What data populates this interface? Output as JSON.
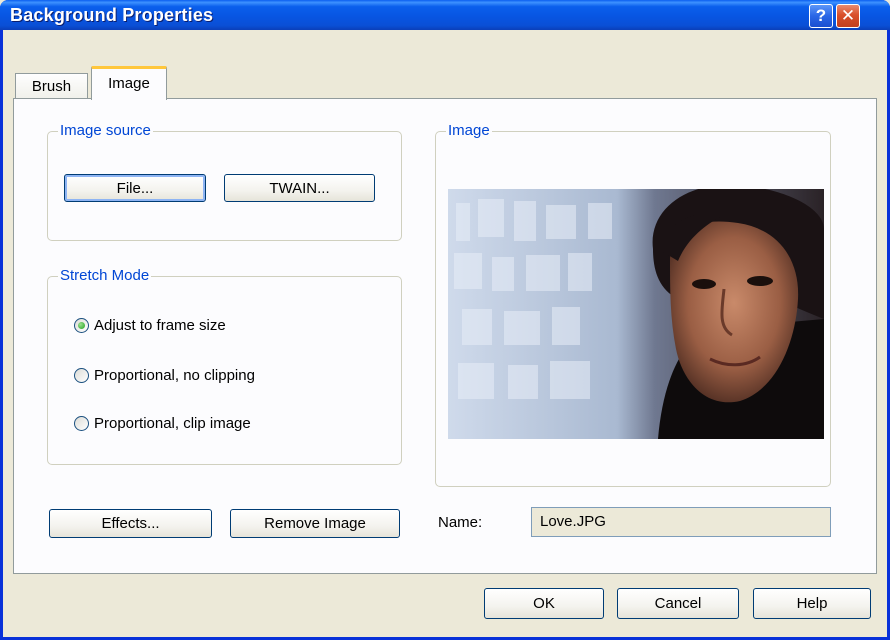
{
  "window": {
    "title": "Background Properties",
    "help_glyph": "?",
    "close_glyph": "✕"
  },
  "tabs": [
    {
      "label": "Brush",
      "selected": false
    },
    {
      "label": "Image",
      "selected": true
    }
  ],
  "image_source": {
    "label": "Image source",
    "file_button": "File...",
    "twain_button": "TWAIN..."
  },
  "stretch_mode": {
    "label": "Stretch Mode",
    "options": [
      {
        "label": "Adjust to frame size",
        "checked": true
      },
      {
        "label": "Proportional, no clipping",
        "checked": false
      },
      {
        "label": "Proportional, clip image",
        "checked": false
      }
    ]
  },
  "image_group": {
    "label": "Image"
  },
  "actions": {
    "effects_button": "Effects...",
    "remove_button": "Remove Image"
  },
  "name": {
    "label": "Name:",
    "value": "Love.JPG"
  },
  "footer": {
    "ok": "OK",
    "cancel": "Cancel",
    "help": "Help"
  },
  "colors": {
    "titlebar": "#0a5fec",
    "group_label": "#0046d5",
    "dialog_bg": "#ece9d8"
  }
}
